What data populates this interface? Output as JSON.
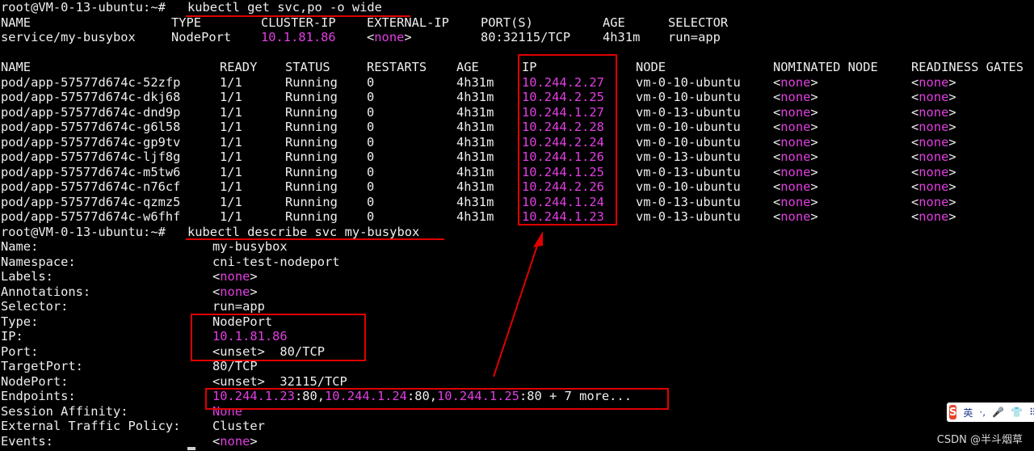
{
  "prompt": "root@VM-0-13-ubuntu:~#",
  "cmd1": "kubectl get svc,po -o wide",
  "svc_headers": [
    "NAME",
    "TYPE",
    "CLUSTER-IP",
    "EXTERNAL-IP",
    "PORT(S)",
    "AGE",
    "SELECTOR"
  ],
  "svc_row": [
    "service/my-busybox",
    "NodePort",
    "10.1.81.86",
    "<none>",
    "80:32115/TCP",
    "4h31m",
    "run=app"
  ],
  "pod_headers": [
    "NAME",
    "READY",
    "STATUS",
    "RESTARTS",
    "AGE",
    "IP",
    "NODE",
    "NOMINATED NODE",
    "READINESS GATES"
  ],
  "pods": [
    [
      "pod/app-57577d674c-52zfp",
      "1/1",
      "Running",
      "0",
      "4h31m",
      "10.244.2.27",
      "vm-0-10-ubuntu",
      "<none>",
      "<none>"
    ],
    [
      "pod/app-57577d674c-dkj68",
      "1/1",
      "Running",
      "0",
      "4h31m",
      "10.244.2.25",
      "vm-0-10-ubuntu",
      "<none>",
      "<none>"
    ],
    [
      "pod/app-57577d674c-dnd9p",
      "1/1",
      "Running",
      "0",
      "4h31m",
      "10.244.1.27",
      "vm-0-13-ubuntu",
      "<none>",
      "<none>"
    ],
    [
      "pod/app-57577d674c-g6l58",
      "1/1",
      "Running",
      "0",
      "4h31m",
      "10.244.2.28",
      "vm-0-10-ubuntu",
      "<none>",
      "<none>"
    ],
    [
      "pod/app-57577d674c-gp9tv",
      "1/1",
      "Running",
      "0",
      "4h31m",
      "10.244.2.24",
      "vm-0-10-ubuntu",
      "<none>",
      "<none>"
    ],
    [
      "pod/app-57577d674c-ljf8g",
      "1/1",
      "Running",
      "0",
      "4h31m",
      "10.244.1.26",
      "vm-0-13-ubuntu",
      "<none>",
      "<none>"
    ],
    [
      "pod/app-57577d674c-m5tw6",
      "1/1",
      "Running",
      "0",
      "4h31m",
      "10.244.1.25",
      "vm-0-13-ubuntu",
      "<none>",
      "<none>"
    ],
    [
      "pod/app-57577d674c-n76cf",
      "1/1",
      "Running",
      "0",
      "4h31m",
      "10.244.2.26",
      "vm-0-10-ubuntu",
      "<none>",
      "<none>"
    ],
    [
      "pod/app-57577d674c-qzmz5",
      "1/1",
      "Running",
      "0",
      "4h31m",
      "10.244.1.24",
      "vm-0-13-ubuntu",
      "<none>",
      "<none>"
    ],
    [
      "pod/app-57577d674c-w6fhf",
      "1/1",
      "Running",
      "0",
      "4h31m",
      "10.244.1.23",
      "vm-0-13-ubuntu",
      "<none>",
      "<none>"
    ]
  ],
  "cmd2": "kubectl describe svc my-busybox",
  "describe": [
    {
      "key": "Name:",
      "value": "my-busybox",
      "color": "plain"
    },
    {
      "key": "Namespace:",
      "value": "cni-test-nodeport",
      "color": "plain"
    },
    {
      "key": "Labels:",
      "value": "<none>",
      "color": "none"
    },
    {
      "key": "Annotations:",
      "value": "<none>",
      "color": "none"
    },
    {
      "key": "Selector:",
      "value": "run=app",
      "color": "plain"
    },
    {
      "key": "Type:",
      "value": "NodePort",
      "color": "plain"
    },
    {
      "key": "IP:",
      "value": "10.1.81.86",
      "color": "magenta"
    },
    {
      "key": "Port:",
      "value": "<unset>  80/TCP",
      "color": "plain"
    },
    {
      "key": "TargetPort:",
      "value": "80/TCP",
      "color": "plain"
    },
    {
      "key": "NodePort:",
      "value": "<unset>  32115/TCP",
      "color": "plain"
    },
    {
      "key": "Endpoints:",
      "value": "",
      "color": "endpoints"
    },
    {
      "key": "Session Affinity:",
      "value": "None",
      "color": "magenta"
    },
    {
      "key": "External Traffic Policy:",
      "value": "Cluster",
      "color": "plain"
    },
    {
      "key": "Events:",
      "value": "<none>",
      "color": "none"
    }
  ],
  "endpoints": {
    "parts": [
      {
        "text": "10.244.1.23",
        "mag": true
      },
      {
        "text": ":80,",
        "mag": false
      },
      {
        "text": "10.244.1.24",
        "mag": true
      },
      {
        "text": ":80,",
        "mag": false
      },
      {
        "text": "10.244.1.25",
        "mag": true
      },
      {
        "text": ":80 + 7 more...",
        "mag": false
      }
    ]
  },
  "ime": {
    "logo": "S",
    "lang": "英",
    "dot": "·,",
    "mic": "🎤",
    "skin": "👕",
    "grid": "⠿"
  },
  "watermark": "CSDN @半斗烟草",
  "colors": {
    "magenta": "#e23ee2",
    "annotation_red": "#e00000",
    "background": "#000000",
    "text": "#eeeeee"
  }
}
